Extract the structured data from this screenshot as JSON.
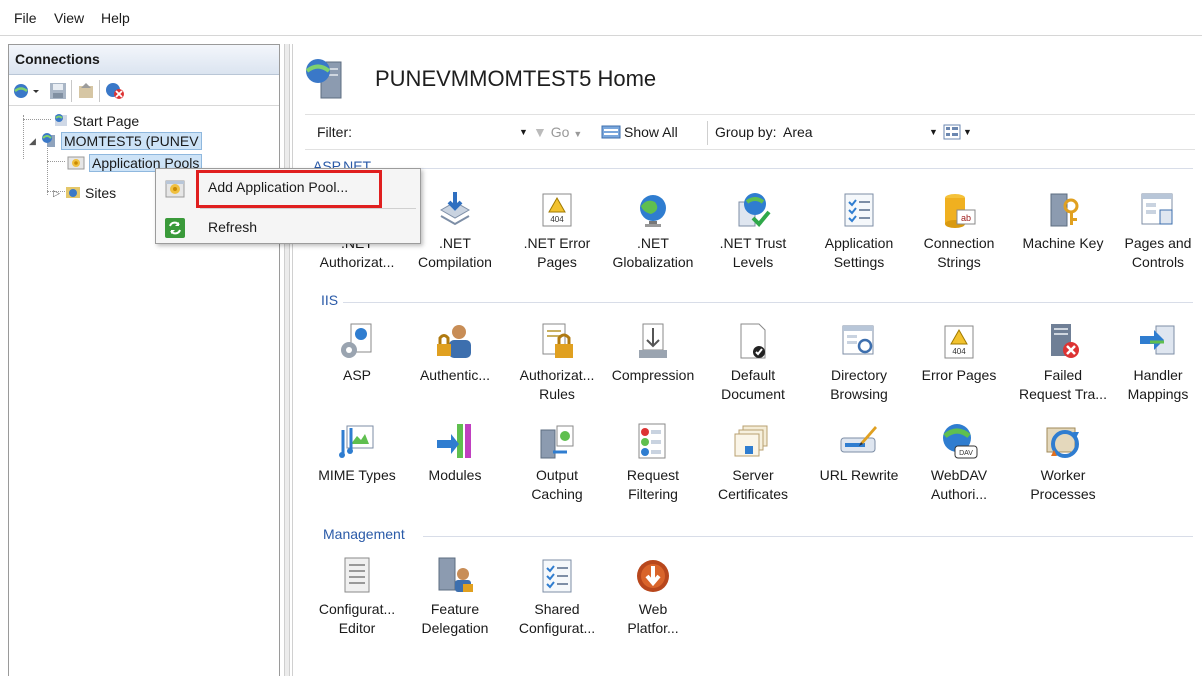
{
  "menubar": {
    "items": [
      "File",
      "View",
      "Help"
    ]
  },
  "connections": {
    "title": "Connections",
    "tree": {
      "start_page": "Start Page",
      "server": "MOMTEST5 (PUNEV",
      "app_pools": "Application Pools",
      "sites": "Sites"
    }
  },
  "main": {
    "title": "PUNEVMMOMTEST5 Home",
    "filter": {
      "label": "Filter:",
      "go": "Go",
      "show_all": "Show All",
      "group_by_label": "Group by:",
      "group_by_value": "Area"
    },
    "sections": [
      {
        "label": "ASP.NET",
        "items": [
          {
            "label": ".NET\nAuthorizat...",
            "icon": "authorization-icon"
          },
          {
            "label": ".NET\nCompilation",
            "icon": "compilation-icon"
          },
          {
            "label": ".NET Error\nPages",
            "icon": "error-page-icon"
          },
          {
            "label": ".NET\nGlobalization",
            "icon": "globe-icon"
          },
          {
            "label": ".NET Trust\nLevels",
            "icon": "trust-icon"
          },
          {
            "label": "Application\nSettings",
            "icon": "settings-list-icon"
          },
          {
            "label": "Connection\nStrings",
            "icon": "database-icon"
          },
          {
            "label": "Machine Key",
            "icon": "key-icon"
          },
          {
            "label": "Pages and\nControls",
            "icon": "pages-icon"
          }
        ]
      },
      {
        "label": "IIS",
        "items": [
          {
            "label": "ASP",
            "icon": "asp-icon"
          },
          {
            "label": "Authentic...",
            "icon": "users-icon"
          },
          {
            "label": "Authorizat...\nRules",
            "icon": "lock-icon"
          },
          {
            "label": "Compression",
            "icon": "compression-icon"
          },
          {
            "label": "Default\nDocument",
            "icon": "document-icon"
          },
          {
            "label": "Directory\nBrowsing",
            "icon": "directory-icon"
          },
          {
            "label": "Error Pages",
            "icon": "error-page-icon"
          },
          {
            "label": "Failed\nRequest Tra...",
            "icon": "failed-icon"
          },
          {
            "label": "Handler\nMappings",
            "icon": "handler-icon"
          },
          {
            "label": "MIME Types",
            "icon": "mime-icon"
          },
          {
            "label": "Modules",
            "icon": "modules-icon"
          },
          {
            "label": "Output\nCaching",
            "icon": "caching-icon"
          },
          {
            "label": "Request\nFiltering",
            "icon": "filter-icon"
          },
          {
            "label": "Server\nCertificates",
            "icon": "certificate-icon"
          },
          {
            "label": "URL Rewrite",
            "icon": "rewrite-icon"
          },
          {
            "label": "WebDAV\nAuthori...",
            "icon": "webdav-icon"
          },
          {
            "label": "Worker\nProcesses",
            "icon": "worker-icon"
          }
        ]
      },
      {
        "label": "Management",
        "items": [
          {
            "label": "Configurat...\nEditor",
            "icon": "config-editor-icon"
          },
          {
            "label": "Feature\nDelegation",
            "icon": "delegation-icon"
          },
          {
            "label": "Shared\nConfigurat...",
            "icon": "shared-config-icon"
          },
          {
            "label": "Web\nPlatfor...",
            "icon": "web-platform-icon"
          }
        ]
      }
    ]
  },
  "context_menu": {
    "items": [
      {
        "label": "Add Application Pool..."
      },
      {
        "label": "Refresh"
      }
    ]
  },
  "colors": {
    "section_label": "#2a5aa8",
    "highlight": "#e01f1f",
    "selection": "#cde3f7"
  }
}
